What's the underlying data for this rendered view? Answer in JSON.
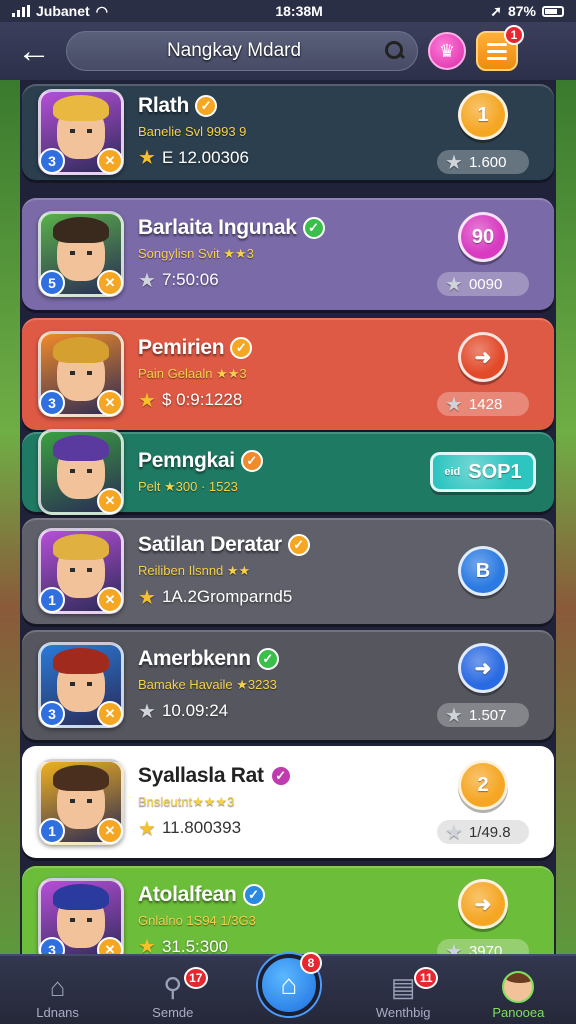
{
  "status_bar": {
    "carrier": "Jubanet",
    "time": "18:38M",
    "battery": "87%"
  },
  "header": {
    "title": "Nangkay Mdard",
    "menu_badge": "1"
  },
  "cards": [
    {
      "name": "Rlath",
      "subtitle": "Banelie Svl 9993 9",
      "score": "E 12.00306",
      "level": "3",
      "action_label": "1",
      "pill_value": "1.600",
      "bg": "#2c3f4e",
      "action_color": "#f5a623",
      "hair": "#e8b840",
      "avatar_bg": "#b64fd8"
    },
    {
      "name": "Barlaita Ingunak",
      "subtitle": "Songylisn Svit ★★3",
      "score": "7:50:06",
      "level": "5",
      "action_label": "90",
      "pill_value": "0090",
      "bg": "#7a6aa8",
      "action_color": "#d83ac0",
      "hair": "#3a2a1e",
      "avatar_bg": "#5ab04a"
    },
    {
      "name": "Pemirien",
      "subtitle": "Pain Gelaaln ★★3",
      "score": "$ 0:9:1228",
      "level": "3",
      "action_label": "",
      "pill_value": "1428",
      "bg": "#de5a45",
      "action_color": "#e24a2a",
      "hair": "#d6a030",
      "avatar_bg": "#f08a2a"
    },
    {
      "name": "Pemngkai",
      "subtitle": "Pelt ★300 · 1523",
      "score": "",
      "level": "",
      "action_label": "SOP1",
      "action_prefix": "eid",
      "pill_value": "",
      "bg": "#1f7a63",
      "action_color": "#2ec4c0",
      "hair": "#5a3a9e",
      "avatar_bg": "#3aa040"
    },
    {
      "name": "Satilan Deratar",
      "subtitle": "Reiliben Ilsnnd ★★",
      "score": "1A.2Gromparnd5",
      "level": "1",
      "action_label": "B",
      "pill_value": "",
      "bg": "#5f6069",
      "action_color": "#2a7ae2",
      "hair": "#e0b040",
      "avatar_bg": "#b64fd8"
    },
    {
      "name": "Amerbkenn",
      "subtitle": "Bamake Havaile ★3233",
      "score": "10.09:24",
      "level": "3",
      "action_label": "",
      "pill_value": "1.507",
      "bg": "#55565e",
      "action_color": "#2a6ae2",
      "hair": "#a02a1e",
      "avatar_bg": "#2a7ad8"
    },
    {
      "name": "Syallasla Rat",
      "subtitle": "Bnsleutnt★★★3",
      "score": "11.800393",
      "level": "1",
      "action_label": "2",
      "pill_value": "1/49.8",
      "bg": "#ffffff",
      "action_color": "#f5a623",
      "hair": "#4a2e1e",
      "avatar_bg": "#f0b020"
    },
    {
      "name": "Atolalfean",
      "subtitle": "Gnlalno 1S94 1/3G3",
      "score": "31.5:300",
      "level": "3",
      "action_label": "",
      "pill_value": "3970",
      "bg": "#6cbd3a",
      "action_color": "#f5a623",
      "hair": "#2a3a9e",
      "avatar_bg": "#b64fd8"
    }
  ],
  "bottom_nav": {
    "items": [
      {
        "label": "Ldnans",
        "icon": "home-icon",
        "badge": ""
      },
      {
        "label": "Semde",
        "icon": "search-people-icon",
        "badge": "17"
      },
      {
        "label": "",
        "icon": "home-fab-icon",
        "badge": "8"
      },
      {
        "label": "Wenthbig",
        "icon": "clipboard-icon",
        "badge": "11"
      },
      {
        "label": "Panooea",
        "icon": "profile-icon",
        "badge": ""
      }
    ]
  }
}
